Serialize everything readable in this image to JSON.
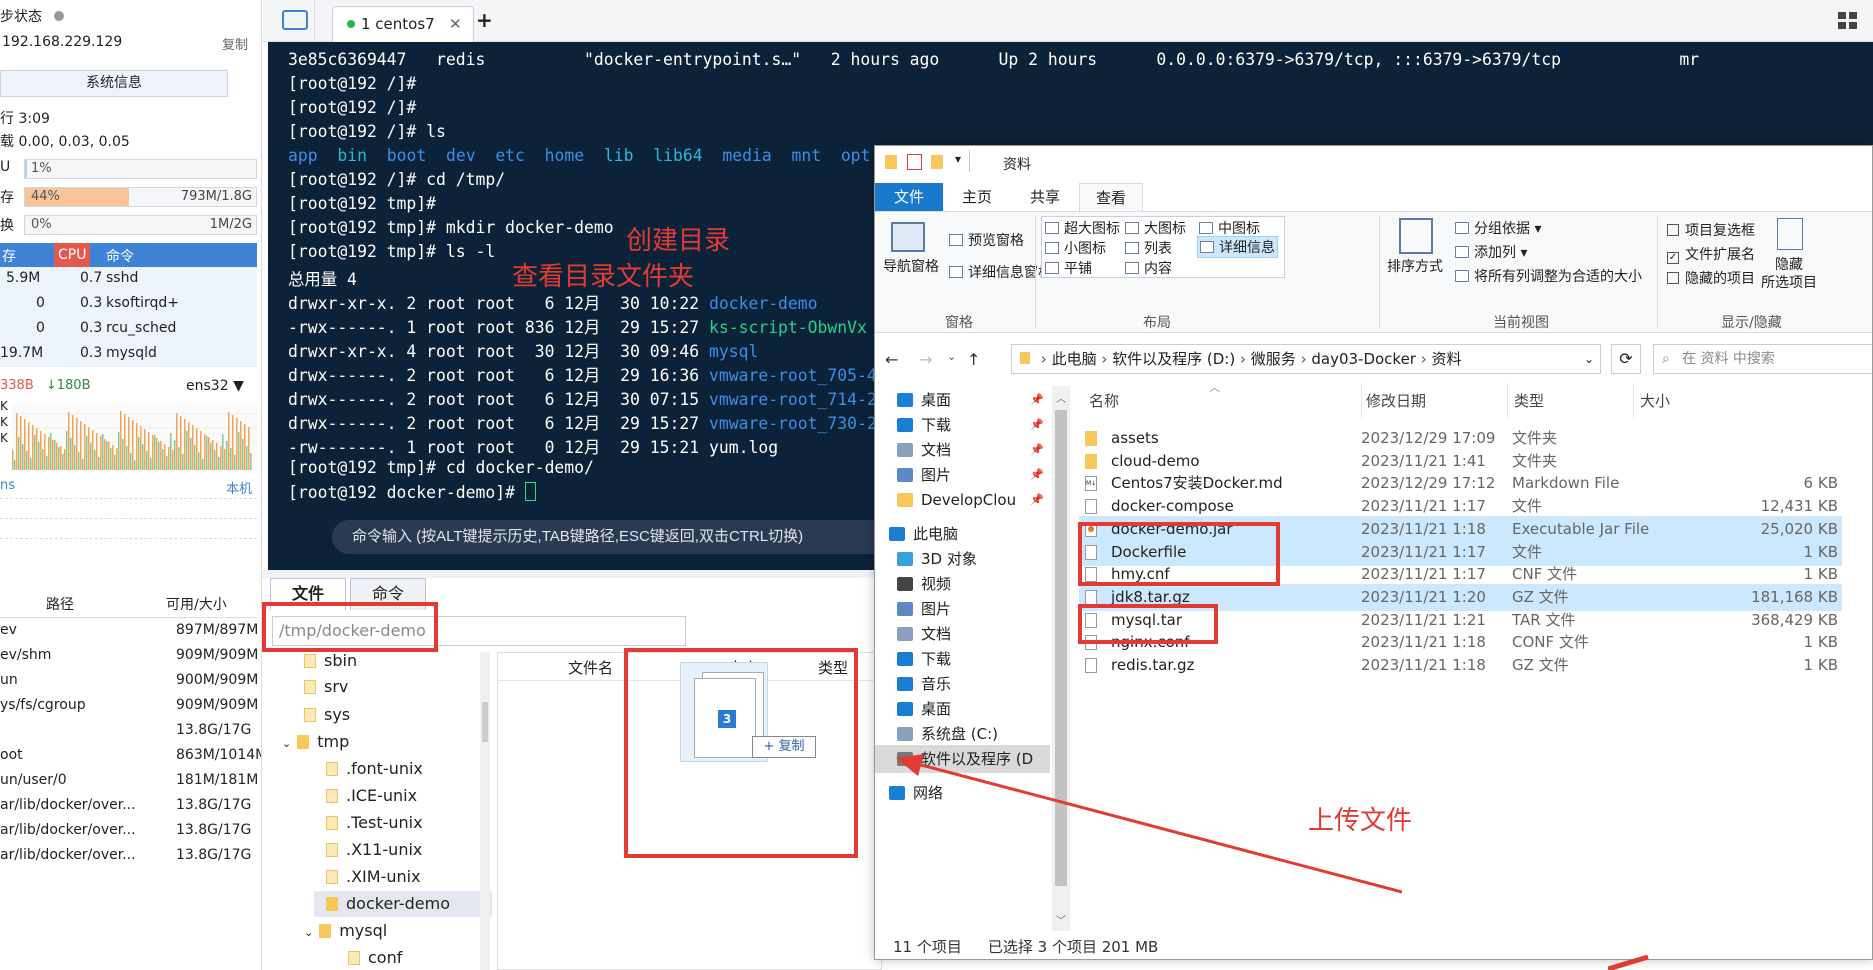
{
  "sysinfo": {
    "sync_label": "步状态",
    "ip": "192.168.229.129",
    "copy": "复制",
    "sysinfo_btn": "系统信息",
    "uptime": "行 3:09",
    "load": "载 0.00, 0.03, 0.05",
    "cpu_label": "U",
    "cpu_pct": "1%",
    "cpu_value": 0.01,
    "mem_label": "存",
    "mem_pct": "44%",
    "mem_value": 0.44,
    "mem_text": "793M/1.8G",
    "swap_label": "换",
    "swap_pct": "0%",
    "swap_value": 0,
    "swap_text": "1M/2G",
    "proc_headers": [
      "存",
      "CPU",
      "命令"
    ],
    "procs": [
      {
        "mem": "5.9M",
        "cpu": "0.7",
        "cmd": "sshd"
      },
      {
        "mem": "0",
        "cpu": "0.3",
        "cmd": "ksoftirqd+"
      },
      {
        "mem": "0",
        "cpu": "0.3",
        "cmd": "rcu_sched"
      },
      {
        "mem": "19.7M",
        "cpu": "0.3",
        "cmd": "mysqld"
      }
    ],
    "net_up": "338B",
    "net_down": "↓180B",
    "net_iface": "ens32",
    "net_ylabels": [
      "K",
      "K",
      "K"
    ],
    "ns_label": "ns",
    "local_label": "本机",
    "disk_headers": [
      "路径",
      "可用/大小"
    ],
    "disks": [
      {
        "path": "ev",
        "size": "897M/897M"
      },
      {
        "path": "ev/shm",
        "size": "909M/909M"
      },
      {
        "path": "un",
        "size": "900M/909M"
      },
      {
        "path": "ys/fs/cgroup",
        "size": "909M/909M"
      },
      {
        "path": "",
        "size": "13.8G/17G"
      },
      {
        "path": "oot",
        "size": "863M/1014M"
      },
      {
        "path": "un/user/0",
        "size": "181M/181M"
      },
      {
        "path": "ar/lib/docker/over...",
        "size": "13.8G/17G"
      },
      {
        "path": "ar/lib/docker/over...",
        "size": "13.8G/17G"
      },
      {
        "path": "ar/lib/docker/over...",
        "size": "13.8G/17G"
      }
    ]
  },
  "tabs": {
    "active": "1 centos7",
    "plus": "+"
  },
  "terminal": {
    "lines": [
      "3e85c6369447   redis          \"docker-entrypoint.s…\"   2 hours ago      Up 2 hours      0.0.0.0:6379->6379/tcp, :::6379->6379/tcp            mr",
      "[root@192 /]#",
      "[root@192 /]#",
      "[root@192 /]# ls"
    ],
    "ls_dirs": [
      "app",
      "bin",
      "boot",
      "dev",
      "etc",
      "home",
      "lib",
      "lib64",
      "media",
      "mnt",
      "opt"
    ],
    "lines2": [
      "[root@192 /]# cd /tmp/",
      "[root@192 tmp]#",
      "[root@192 tmp]# mkdir docker-demo",
      "[root@192 tmp]# ls -l",
      "总用量 4"
    ],
    "listing": [
      {
        "meta": "drwxr-xr-x. 2 root root   6 12月  30 10:22 ",
        "name": "docker-demo",
        "color": "#3b8eea"
      },
      {
        "meta": "-rwx------. 1 root root 836 12月  29 15:27 ",
        "name": "ks-script-ObwnVx",
        "color": "#23d18b"
      },
      {
        "meta": "drwxr-xr-x. 4 root root  30 12月  30 09:46 ",
        "name": "mysql",
        "color": "#3b8eea"
      },
      {
        "meta": "drwx------. 2 root root   6 12月  29 16:36 ",
        "name": "vmware-root_705-4",
        "color": "#3b8eea"
      },
      {
        "meta": "drwx------. 2 root root   6 12月  30 07:15 ",
        "name": "vmware-root_714-2",
        "color": "#3b8eea"
      },
      {
        "meta": "drwx------. 2 root root   6 12月  29 15:27 ",
        "name": "vmware-root_730-2",
        "color": "#3b8eea"
      },
      {
        "meta": "-rw-------. 1 root root   0 12月  29 15:21 ",
        "name": "yum.log",
        "color": "#ffffff"
      }
    ],
    "lines3": [
      "[root@192 tmp]# cd docker-demo/",
      "[root@192 docker-demo]# "
    ],
    "cmd_hint": "命令输入 (按ALT键提示历史,TAB键路径,ESC键返回,双击CTRL切换)"
  },
  "sftp": {
    "tab_files": "文件",
    "tab_cmd": "命令",
    "path": "/tmp/docker-demo",
    "tree": [
      "sbin",
      "srv",
      "sys",
      "tmp",
      ".font-unix",
      ".ICE-unix",
      ".Test-unix",
      ".X11-unix",
      ".XIM-unix",
      "docker-demo",
      "mysql",
      "conf"
    ],
    "col_name": "文件名",
    "col_size": "大小",
    "col_type": "类型",
    "drag_count": "3",
    "drag_copy": "+ 复制"
  },
  "explorer": {
    "title": "资料",
    "ribbon_tabs": [
      "文件",
      "主页",
      "共享",
      "查看"
    ],
    "nav_pane": "导航窗格",
    "preview_pane": "预览窗格",
    "details_pane": "详细信息窗格",
    "group_panes": "窗格",
    "layout_items": [
      "超大图标",
      "大图标",
      "中图标",
      "小图标",
      "列表",
      "详细信息",
      "平铺",
      "内容"
    ],
    "group_layout": "布局",
    "sort_by": "排序方式",
    "group_by": "分组依据",
    "add_col": "添加列",
    "fit_cols": "将所有列调整为合适的大小",
    "group_current": "当前视图",
    "chk_items": "项目复选框",
    "chk_ext": "文件扩展名",
    "chk_hidden": "隐藏的项目",
    "hide_selected": "隐藏",
    "hide_selected2": "所选项目",
    "group_show": "显示/隐藏",
    "breadcrumbs": [
      "此电脑",
      "软件以及程序 (D:)",
      "微服务",
      "day03-Docker",
      "资料"
    ],
    "search": "在 资料 中搜索",
    "nav": [
      "桌面",
      "下载",
      "文档",
      "图片",
      "DevelopClou",
      "此电脑",
      "3D 对象",
      "视频",
      "图片",
      "文档",
      "下载",
      "音乐",
      "桌面",
      "系统盘 (C:)",
      "软件以及程序 (D",
      "网络"
    ],
    "col_headers": [
      "名称",
      "修改日期",
      "类型",
      "大小"
    ],
    "files": [
      {
        "name": "assets",
        "date": "2023/12/29 17:09",
        "type": "文件夹",
        "size": "",
        "kind": "folder",
        "sel": false
      },
      {
        "name": "cloud-demo",
        "date": "2023/11/21 1:41",
        "type": "文件夹",
        "size": "",
        "kind": "folder",
        "sel": false
      },
      {
        "name": "Centos7安装Docker.md",
        "date": "2023/12/29 17:12",
        "type": "Markdown File",
        "size": "6 KB",
        "kind": "md",
        "sel": false
      },
      {
        "name": "docker-compose",
        "date": "2023/11/21 1:17",
        "type": "文件",
        "size": "12,431 KB",
        "kind": "file",
        "sel": false
      },
      {
        "name": "docker-demo.jar",
        "date": "2023/11/21 1:18",
        "type": "Executable Jar File",
        "size": "25,020 KB",
        "kind": "jar",
        "sel": true
      },
      {
        "name": "Dockerfile",
        "date": "2023/11/21 1:17",
        "type": "文件",
        "size": "1 KB",
        "kind": "file",
        "sel": true
      },
      {
        "name": "hmy.cnf",
        "date": "2023/11/21 1:17",
        "type": "CNF 文件",
        "size": "1 KB",
        "kind": "file",
        "sel": false
      },
      {
        "name": "jdk8.tar.gz",
        "date": "2023/11/21 1:20",
        "type": "GZ 文件",
        "size": "181,168 KB",
        "kind": "file",
        "sel": true
      },
      {
        "name": "mysql.tar",
        "date": "2023/11/21 1:21",
        "type": "TAR 文件",
        "size": "368,429 KB",
        "kind": "file",
        "sel": false
      },
      {
        "name": "nginx.conf",
        "date": "2023/11/21 1:18",
        "type": "CONF 文件",
        "size": "1 KB",
        "kind": "file",
        "sel": false
      },
      {
        "name": "redis.tar.gz",
        "date": "2023/11/21 1:18",
        "type": "GZ 文件",
        "size": "1 KB",
        "kind": "file",
        "sel": false
      }
    ],
    "status_count": "11 个项目",
    "status_sel": "已选择 3 个项目  201 MB"
  },
  "annotations": {
    "mkdir": "创建目录",
    "ls": "查看目录文件夹",
    "upload": "上传文件"
  },
  "colors": {
    "terminal_bg": "#0c2239",
    "accent": "#3f83d6",
    "annotation_red": "#e23b32",
    "selection": "#cce8ff"
  }
}
